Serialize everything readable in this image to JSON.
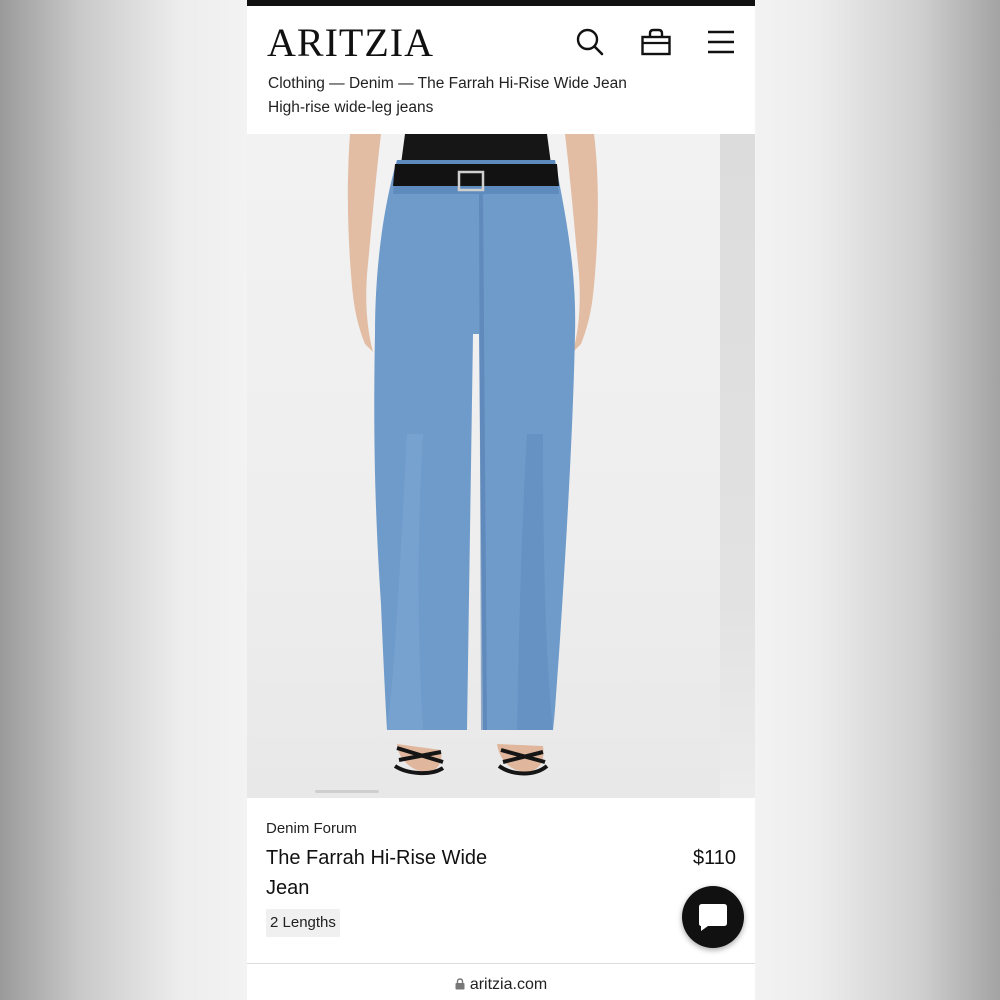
{
  "header": {
    "logo": "ARITZIA",
    "icons": [
      "search-icon",
      "bag-icon",
      "menu-icon"
    ]
  },
  "breadcrumb": {
    "text": "Clothing — Denim — The Farrah Hi-Rise Wide Jean"
  },
  "product": {
    "subtitle": "High-rise wide-leg jeans",
    "brand": "Denim Forum",
    "name": "The Farrah Hi-Rise Wide Jean",
    "price": "$110",
    "lengths_badge": "2 Lengths"
  },
  "colors": {
    "denim": "#6f9bcb",
    "denim_dark": "#4f7fb3",
    "chat_button": "#111111"
  },
  "browser": {
    "url": "aritzia.com"
  }
}
